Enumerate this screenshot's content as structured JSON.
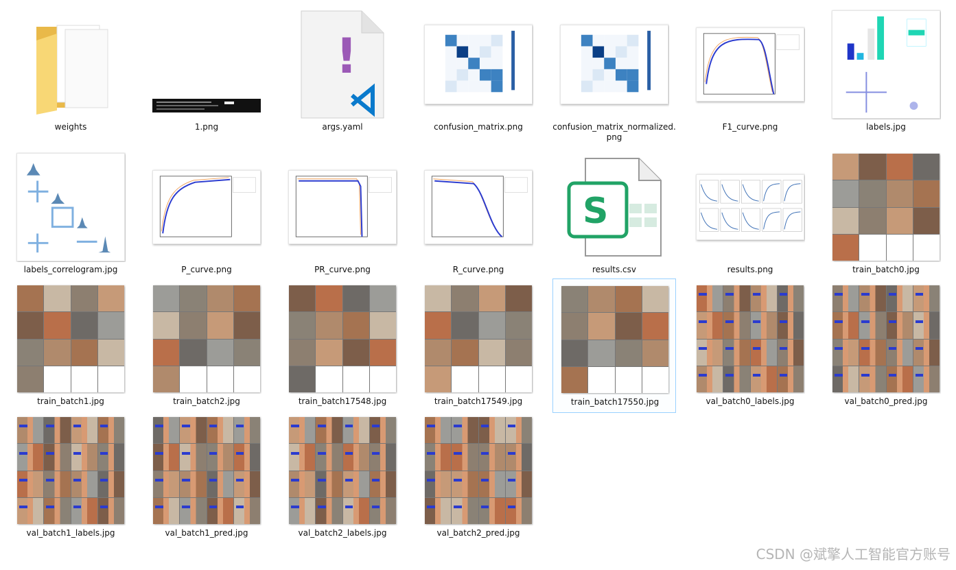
{
  "files": [
    {
      "name": "weights",
      "kind": "folder"
    },
    {
      "name": "1.png",
      "kind": "terminal"
    },
    {
      "name": "args.yaml",
      "kind": "yaml"
    },
    {
      "name": "confusion_matrix.png",
      "kind": "matrix"
    },
    {
      "name": "confusion_matrix_normalized.png",
      "kind": "matrix"
    },
    {
      "name": "F1_curve.png",
      "kind": "curve"
    },
    {
      "name": "labels.jpg",
      "kind": "labels"
    },
    {
      "name": "labels_correlogram.jpg",
      "kind": "correlogram"
    },
    {
      "name": "P_curve.png",
      "kind": "curve"
    },
    {
      "name": "PR_curve.png",
      "kind": "prcurve"
    },
    {
      "name": "R_curve.png",
      "kind": "curve"
    },
    {
      "name": "results.csv",
      "kind": "csv"
    },
    {
      "name": "results.png",
      "kind": "results"
    },
    {
      "name": "train_batch0.jpg",
      "kind": "mosaic"
    },
    {
      "name": "train_batch1.jpg",
      "kind": "mosaic"
    },
    {
      "name": "train_batch2.jpg",
      "kind": "mosaic"
    },
    {
      "name": "train_batch17548.jpg",
      "kind": "mosaic"
    },
    {
      "name": "train_batch17549.jpg",
      "kind": "mosaic"
    },
    {
      "name": "train_batch17550.jpg",
      "kind": "mosaic",
      "selected": true
    },
    {
      "name": "val_batch0_labels.jpg",
      "kind": "valgrid"
    },
    {
      "name": "val_batch0_pred.jpg",
      "kind": "valgrid"
    },
    {
      "name": "val_batch1_labels.jpg",
      "kind": "valgrid"
    },
    {
      "name": "val_batch1_pred.jpg",
      "kind": "valgrid"
    },
    {
      "name": "val_batch2_labels.jpg",
      "kind": "valgrid"
    },
    {
      "name": "val_batch2_pred.jpg",
      "kind": "valgrid"
    }
  ],
  "watermark": "CSDN @斌擎人工智能官方账号",
  "colors": {
    "folder": "#f8d775",
    "yaml_mark": "#9b59b6",
    "vscode": "#0a7acc",
    "sheets": "#21a366",
    "selection_border": "#99d1ff"
  }
}
